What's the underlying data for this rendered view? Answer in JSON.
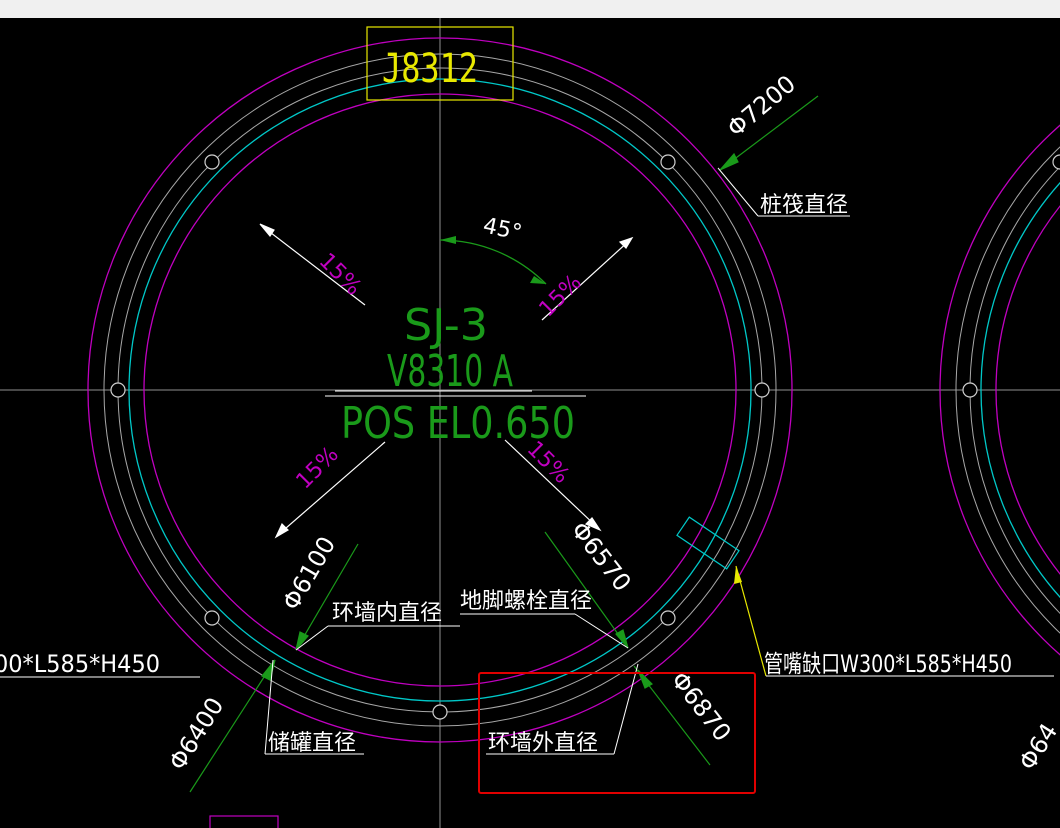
{
  "colors": {
    "background": "#000000",
    "topbar": "#f0f0f0",
    "magenta": "#c000c0",
    "cyan": "#00c8c8",
    "gray": "#a0a0a0",
    "green": "#1a9a1a",
    "white": "#ffffff",
    "yellow": "#e8e800",
    "red": "#e00000"
  },
  "texts": {
    "equipment_tag": "J8312",
    "title_line1": "SJ-3",
    "title_line2": "V8310 A",
    "title_line3": "POS EL0.650",
    "angle": "45°",
    "slope_nw": "15%",
    "slope_ne": "15%",
    "slope_sw": "15%",
    "slope_se": "15%",
    "dim_7200": "Φ7200",
    "dim_6100": "Φ6100",
    "dim_6570": "Φ6570",
    "dim_6870": "Φ6870",
    "dim_6400": "Φ6400",
    "dim_6400_right": "Φ64",
    "label_raft_diameter": "桩筏直径",
    "label_inner_wall": "环墙内直径",
    "label_bolt_circle": "地脚螺栓直径",
    "label_outer_wall": "环墙外直径",
    "label_tank_diameter": "储罐直径",
    "label_nozzle_notch": "管嘴缺口W300*L585*H450",
    "label_left_cut": "00*L585*H450"
  }
}
